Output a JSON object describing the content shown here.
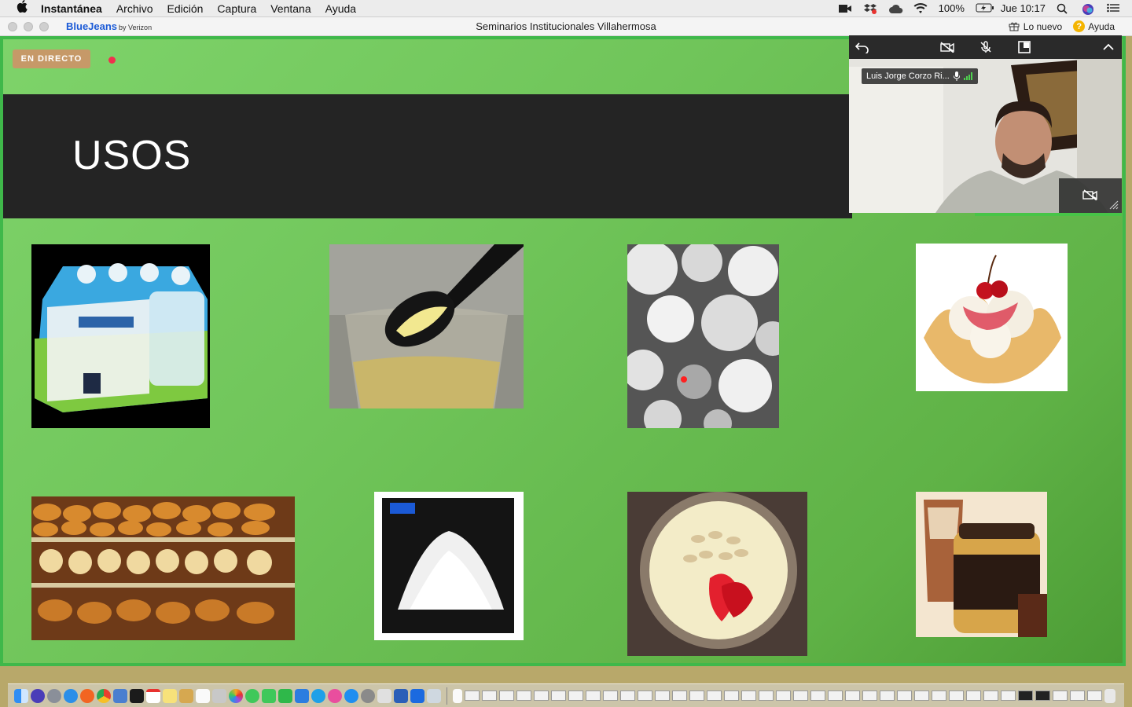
{
  "menubar": {
    "app_name": "Instantánea",
    "items": [
      "Archivo",
      "Edición",
      "Captura",
      "Ventana",
      "Ayuda"
    ],
    "battery": "100%",
    "clock": "Jue 10:17"
  },
  "titlebar": {
    "brand": "BlueJeans",
    "brand_suffix": "by Verizon",
    "window_title": "Seminarios Institucionales Villahermosa",
    "whats_new": "Lo nuevo",
    "help": "Ayuda",
    "help_symbol": "?"
  },
  "slide": {
    "live_label": "EN DIRECTO",
    "title": "USOS"
  },
  "video": {
    "participant_name": "Luis Jorge Corzo Ri..."
  }
}
